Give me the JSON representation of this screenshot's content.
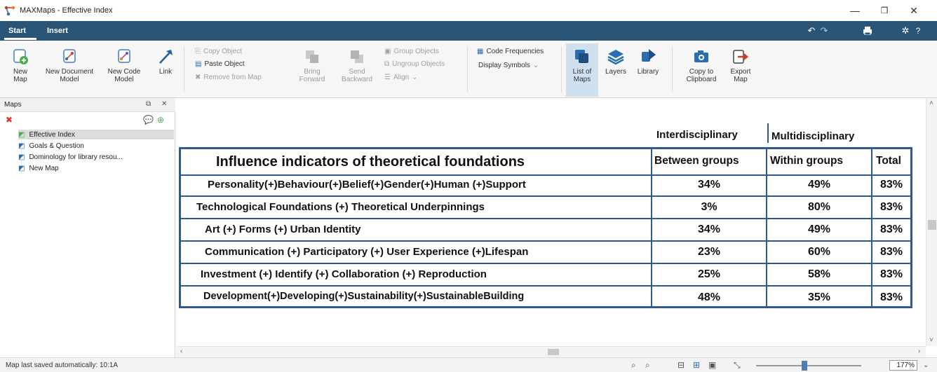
{
  "window": {
    "title": "MAXMaps - Effective Index",
    "minimize_glyph": "—",
    "maximize_glyph": "❐",
    "close_glyph": "✕"
  },
  "tabs": [
    "Start",
    "Insert"
  ],
  "tabbar_icons": [
    "undo-icon",
    "redo-icon",
    "print-icon",
    "settings-icon",
    "help-icon"
  ],
  "ribbon": {
    "new_map": "New Map",
    "new_document_model": "New Document Model",
    "new_code_model": "New Code Model",
    "link": "Link",
    "copy_object": "Copy Object",
    "paste_object": "Paste Object",
    "remove_from_map": "Remove from Map",
    "bring_forward": "Bring Forward",
    "send_backward": "Send Backward",
    "group_objects": "Group Objects",
    "ungroup_objects": "Ungroup Objects",
    "align": "Align",
    "code_frequencies": "Code Frequencies",
    "display_symbols": "Display Symbols",
    "list_of_maps": "List of Maps",
    "layers": "Layers",
    "library": "Library",
    "copy_to_clipboard": "Copy to Clipboard",
    "export_map": "Export Map"
  },
  "panel": {
    "title": "Maps",
    "items": [
      {
        "label": "Effective Index",
        "selected": true,
        "icon": "map-active-icon"
      },
      {
        "label": "Goals & Question",
        "selected": false,
        "icon": "map-icon"
      },
      {
        "label": "Dominology for library resou...",
        "selected": false,
        "icon": "map-icon"
      },
      {
        "label": "New Map",
        "selected": false,
        "icon": "map-icon"
      }
    ]
  },
  "map": {
    "group_headers": [
      "Interdisciplinary",
      "Multidisciplinary"
    ],
    "column_headers": [
      "Influence indicators of theoretical foundations",
      "Between groups",
      "Within groups",
      "Total"
    ],
    "rows": [
      {
        "label": "Personality(+)Behaviour(+)Belief(+)Gender(+)Human (+)Support",
        "between": "34%",
        "within": "49%",
        "total": "83%"
      },
      {
        "label": "Technological Foundations (+) Theoretical Underpinnings",
        "between": "3%",
        "within": "80%",
        "total": "83%"
      },
      {
        "label": "Art (+) Forms (+) Urban Identity",
        "between": "34%",
        "within": "49%",
        "total": "83%"
      },
      {
        "label": "Communication (+) Participatory (+) User Experience (+)Lifespan",
        "between": "23%",
        "within": "60%",
        "total": "83%"
      },
      {
        "label": "Investment (+) Identify (+) Collaboration (+) Reproduction",
        "between": "25%",
        "within": "58%",
        "total": "83%"
      },
      {
        "label": "Development(+)Developing(+)Sustainability(+)SustainableBuilding",
        "between": "48%",
        "within": "35%",
        "total": "83%"
      }
    ],
    "border_color": "#2e5a8c"
  },
  "status": {
    "text": "Map last saved automatically: 10:1A",
    "zoom": "177%",
    "zoom_fraction": 0.46
  },
  "colors": {
    "ribbon_tab_bar": "#2b5577",
    "selection": "#cfe0ef",
    "accent_green": "#4caf50",
    "accent_blue": "#2a6db0",
    "accent_red": "#d23b2b"
  }
}
